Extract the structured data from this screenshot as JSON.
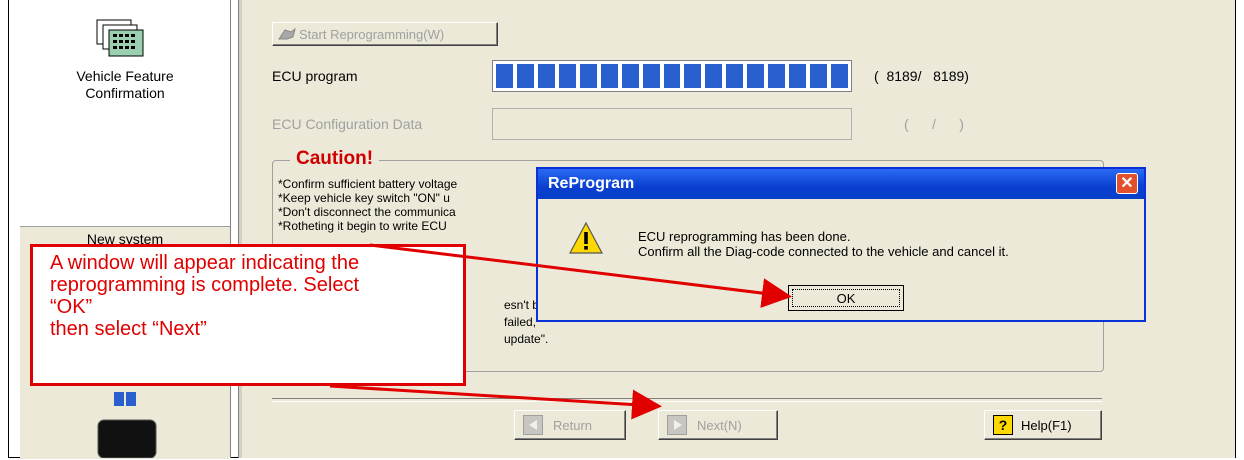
{
  "sidebar": {
    "item1_label": "Vehicle Feature\nConfirmation",
    "item2_label": "New system"
  },
  "main": {
    "start_button": "Start Reprogramming(W)",
    "ecu_program_label": "ECU program",
    "ecu_program_count": "(  8189/   8189)",
    "ecu_program_progress": 1.0,
    "ecu_config_label": "ECU Configuration Data",
    "ecu_config_count": "(      /      )",
    "caution_title": "Caution!",
    "caution_lines": [
      "*Confirm sufficient  battery voltage",
      "*Keep vehicle key switch \"ON\" u",
      "*Don't disconnect the communica",
      "*Rotheting it begin to write ECU"
    ],
    "tail_lines": [
      "esn't be",
      "failed,",
      "update\"."
    ],
    "return_button": "Return",
    "next_button": "Next(N)",
    "help_button": "Help(F1)"
  },
  "dialog": {
    "title": "ReProgram",
    "close_glyph": "✕",
    "message": "ECU reprogramming has been done.\nConfirm all the Diag-code connected to the vehicle and cancel it.",
    "ok_button": "OK"
  },
  "annotation": {
    "text": "A window will appear indicating the\nreprogramming is complete. Select\n“OK”\nthen select “Next”",
    "color": "#e00000"
  },
  "colors": {
    "progress": "#2a5fce",
    "title_bar": "#0a3fd0",
    "caution": "#d00000"
  }
}
